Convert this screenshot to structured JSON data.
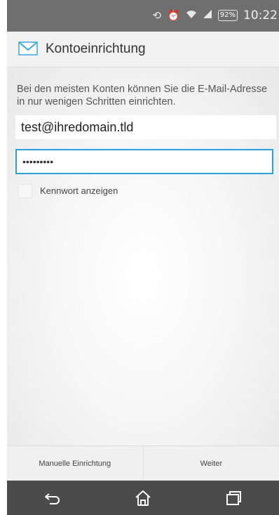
{
  "status_bar": {
    "time": "10:22",
    "battery_text": "92%",
    "icons": [
      "screen-rotation-icon",
      "alarm-icon",
      "wifi-icon",
      "signal-icon",
      "battery-icon"
    ]
  },
  "action_bar": {
    "title": "Kontoeinrichtung",
    "icon": "mail-envelope-icon"
  },
  "form": {
    "intro_text": "Bei den meisten Konten können Sie die E-Mail-Adresse in nur wenigen Schritten einrichten.",
    "email_value": "test@ihredomain.tld",
    "password_value": "•••••••••",
    "show_password_label": "Kennwort anzeigen",
    "show_password_checked": false
  },
  "buttons": {
    "manual_label": "Manuelle Einrichtung",
    "next_label": "Weiter"
  },
  "nav_bar": {
    "icons": [
      "back-icon",
      "home-icon",
      "recent-apps-icon"
    ]
  },
  "colors": {
    "status_bar": "#6f6f6f",
    "accent": "#27a3d9",
    "nav_bar": "#4b4b4b",
    "mail_icon": "#3aa7dc"
  }
}
